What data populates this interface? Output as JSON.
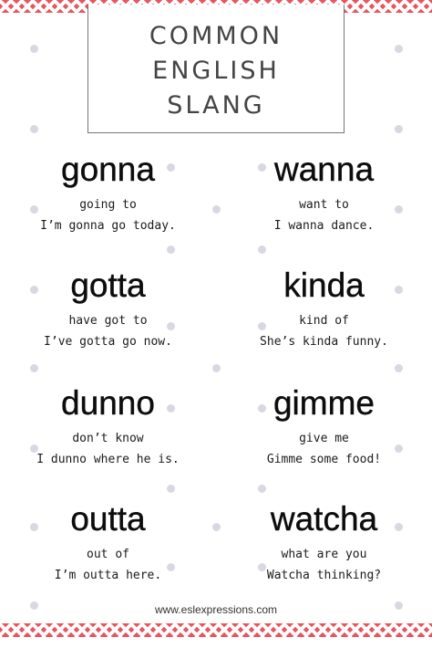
{
  "title": {
    "lines": [
      "COMMON",
      "ENGLISH",
      "SLANG"
    ]
  },
  "entries": [
    {
      "word": "gonna",
      "meaning": "going to",
      "example": "I’m gonna go today."
    },
    {
      "word": "wanna",
      "meaning": "want to",
      "example": "I wanna dance."
    },
    {
      "word": "gotta",
      "meaning": "have got to",
      "example": "I’ve gotta go now."
    },
    {
      "word": "kinda",
      "meaning": "kind of",
      "example": "She’s kinda funny."
    },
    {
      "word": "dunno",
      "meaning": "don’t know",
      "example": "I dunno where he is."
    },
    {
      "word": "gimme",
      "meaning": "give me",
      "example": "Gimme some food!"
    },
    {
      "word": "outta",
      "meaning": "out of",
      "example": "I’m outta here."
    },
    {
      "word": "watcha",
      "meaning": "what are you",
      "example": "Watcha thinking?"
    }
  ],
  "footer": {
    "url": "www.eslexpressions.com"
  },
  "colors": {
    "border_accent": "#e8555e",
    "dot": "#d8d8e2",
    "title_text": "#444444"
  }
}
